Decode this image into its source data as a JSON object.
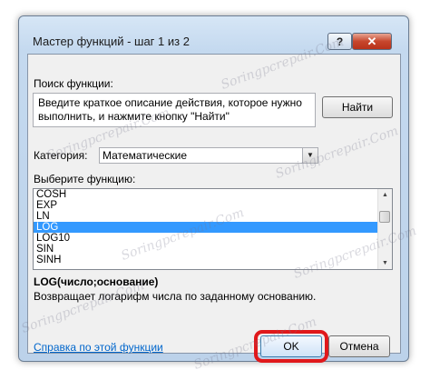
{
  "window": {
    "title": "Мастер функций - шаг 1 из 2",
    "help_glyph": "?",
    "close_glyph": "✕"
  },
  "search": {
    "label": "Поиск функции:",
    "text_line1": "Введите краткое описание действия, которое нужно",
    "text_line2": "выполнить, и нажмите кнопку \"Найти\"",
    "find_button": "Найти"
  },
  "category": {
    "label": "Категория:",
    "selected": "Математические",
    "arrow_glyph": "▼"
  },
  "function_list": {
    "label": "Выберите функцию:",
    "items": [
      "COSH",
      "EXP",
      "LN",
      "LOG",
      "LOG10",
      "SIN",
      "SINH"
    ],
    "selected_index": 3,
    "scroll_up_glyph": "▲",
    "scroll_down_glyph": "▼"
  },
  "signature": "LOG(число;основание)",
  "description": "Возвращает логарифм числа по заданному основанию.",
  "help_link": "Справка по этой функции",
  "buttons": {
    "ok": "OK",
    "cancel": "Отмена"
  },
  "watermark": "Soringpcrepair.Com",
  "colors": {
    "selection": "#3399ff",
    "highlight_outline": "#e0181b",
    "link": "#0066cc"
  }
}
